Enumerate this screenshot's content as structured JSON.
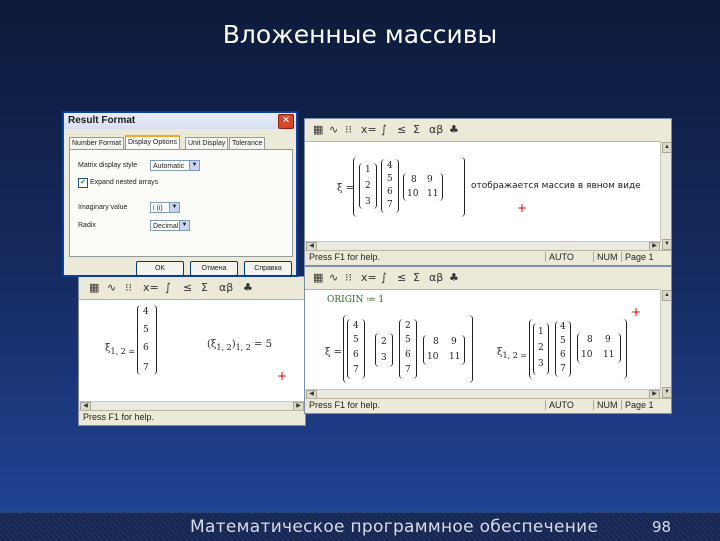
{
  "slide": {
    "title": "Вложенные массивы",
    "footer": "Математическое программное обеспечение",
    "page_number": "98"
  },
  "dialog": {
    "title": "Result Format",
    "close_label": "✕",
    "tabs": [
      "Number Format",
      "Display Options",
      "Unit Display",
      "Tolerance"
    ],
    "matrix_style_label": "Matrix display style",
    "matrix_style_value": "Automatic",
    "expand_label": "Expand nested arrays",
    "imaginary_label": "Imaginary value",
    "imaginary_value": "i (i)",
    "radix_label": "Radix",
    "radix_value": "Decimal",
    "buttons": [
      "OK",
      "Отмена",
      "Справка"
    ]
  },
  "toolbar_icons": [
    "calculator-icon",
    "graph-icon",
    "matrix-icon",
    "evaluation-icon",
    "calculus-icon",
    "boolean-icon",
    "programming-icon",
    "greek-icon",
    "symbolic-icon"
  ],
  "toolbar_glyphs": [
    "▦",
    "∿",
    "[:::]",
    "x=",
    "∫",
    "≤",
    "Σ",
    "αβ",
    "🎓"
  ],
  "window_top": {
    "var": "ξ =",
    "note": "отображается массив в явном виде",
    "status_help": "Press F1 for help.",
    "status_mode": "AUTO",
    "status_num": "NUM",
    "status_page": "Page 1"
  },
  "window_bl": {
    "expr1": "ξ",
    "expr1_sub": "1, 2 =",
    "expr2": "(ξ",
    "expr2_sub": "1, 2",
    "expr2_tail": ")",
    "expr2_sub2": "1, 2",
    "expr2_eq": "= 5",
    "status_help": "Press F1 for help."
  },
  "window_br": {
    "origin": "ORIGIN ≔ 1",
    "xi_label": "ξ =",
    "xi12_label": "ξ",
    "xi12_sub": "1, 2 =",
    "status_help": "Press F1 for help.",
    "status_mode": "AUTO",
    "status_num": "NUM",
    "status_page": "Page 1"
  },
  "matrices": {
    "m_col4": [
      "4",
      "5",
      "6",
      "7"
    ],
    "m_col1": [
      "1",
      "2",
      "3"
    ],
    "m_col2": [
      "2",
      "3"
    ],
    "m_col3": [
      "2",
      "5",
      "6",
      "7"
    ],
    "m_pair1": [
      "8",
      "9"
    ],
    "m_pair2": [
      "10",
      "11"
    ]
  }
}
